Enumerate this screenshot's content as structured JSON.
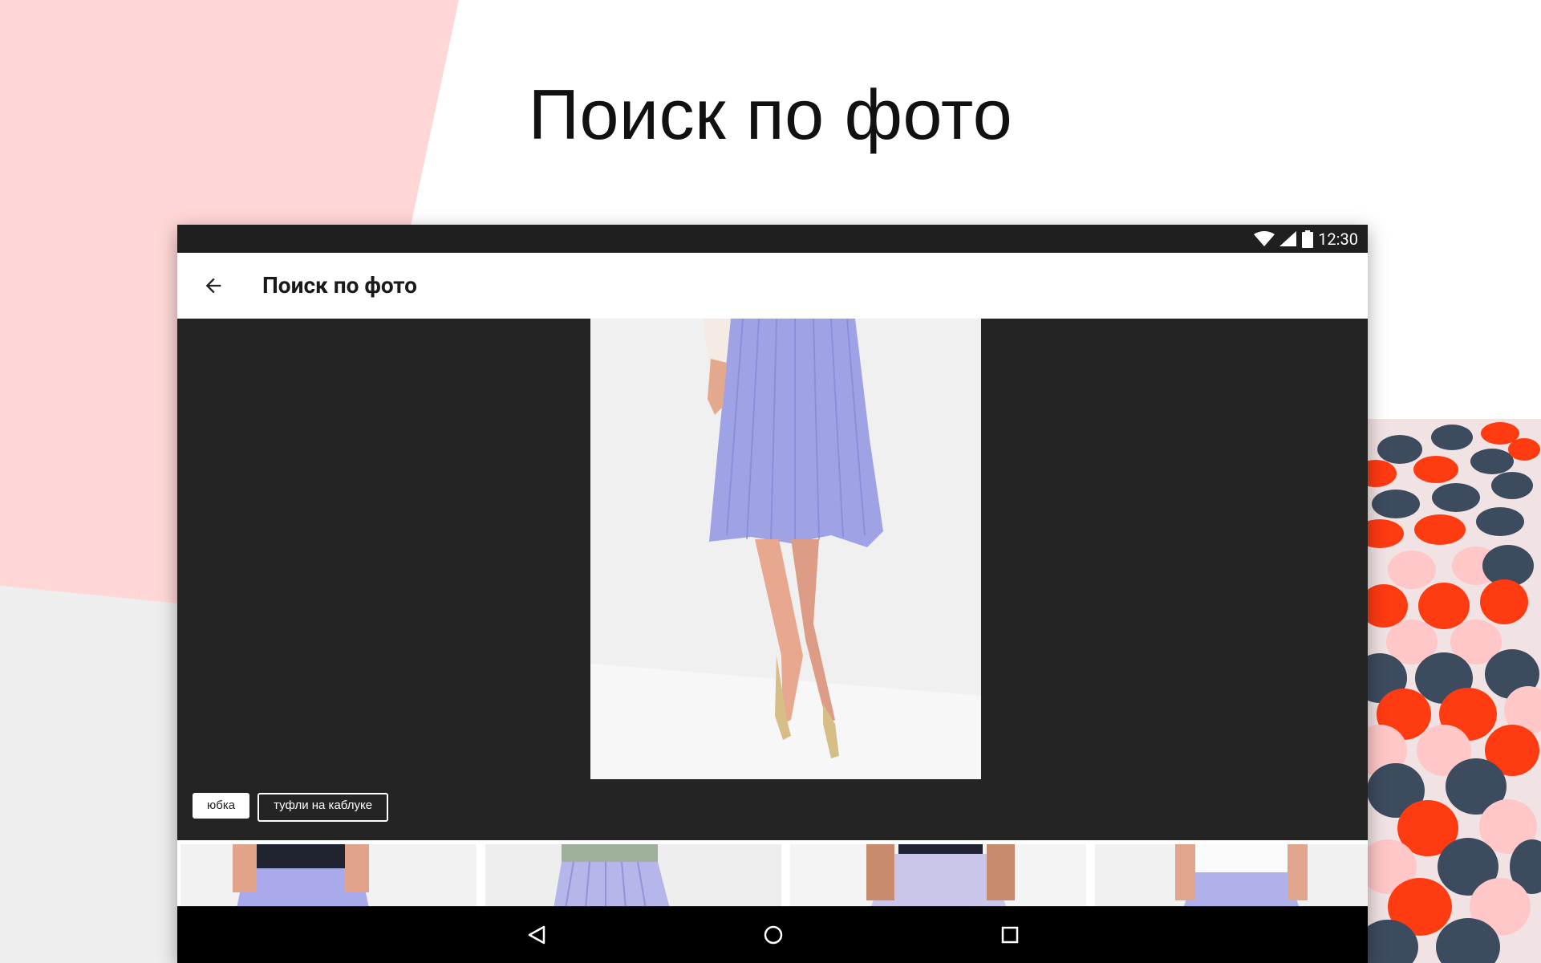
{
  "headline": "Поиск по фото",
  "status_bar": {
    "time": "12:30",
    "icons": [
      "wifi-icon",
      "signal-icon",
      "battery-icon"
    ]
  },
  "app_bar": {
    "title": "Поиск по фото",
    "back_icon": "arrow-back-icon"
  },
  "tags": [
    {
      "label": "юбка",
      "selected": true
    },
    {
      "label": "туфли на каблуке",
      "selected": false
    }
  ],
  "nav_bar": {
    "icons": [
      "back-triangle-icon",
      "home-circle-icon",
      "recents-square-icon"
    ]
  },
  "colors": {
    "accent_pink": "#ffd7d7",
    "dark_surface": "#242424",
    "dot_orange": "#ff3b12",
    "dot_navy": "#3d4b5f"
  }
}
